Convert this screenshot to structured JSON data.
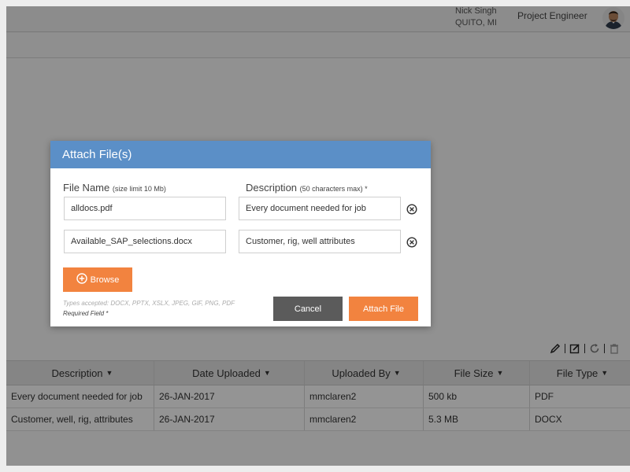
{
  "header": {
    "user_name": "Nick Singh",
    "user_location": "QUITO, MI",
    "user_role": "Project Engineer"
  },
  "modal": {
    "title": "Attach File(s)",
    "file_name_label": "File Name",
    "file_name_hint": "(size limit 10 Mb)",
    "description_label": "Description",
    "description_hint": "(50 characters max) *",
    "files": [
      {
        "name": "alldocs.pdf",
        "description": "Every document needed for job"
      },
      {
        "name": "Available_SAP_selections.docx",
        "description": "Customer, rig, well attributes"
      }
    ],
    "browse_label": "Browse",
    "types_accepted": "Types accepted: DOCX, PPTX, XSLX, JPEG, GIF, PNG, PDF",
    "required_note": "Required Field *",
    "cancel_label": "Cancel",
    "attach_label": "Attach File"
  },
  "grid": {
    "columns": [
      "Description",
      "Date Uploaded",
      "Uploaded By",
      "File Size",
      "File Type"
    ],
    "rows": [
      [
        "Every document needed for job",
        "26-JAN-2017",
        "mmclaren2",
        "500 kb",
        "PDF"
      ],
      [
        "Customer, well, rig, attributes",
        "26-JAN-2017",
        "mmclaren2",
        "5.3 MB",
        "DOCX"
      ]
    ]
  },
  "colors": {
    "modal_header": "#5b8fc7",
    "accent_orange": "#f2833f",
    "cancel_gray": "#5b5b5b"
  },
  "icons": [
    "avatar",
    "edit-icon",
    "note-icon",
    "refresh-icon",
    "trash-icon",
    "remove-icon",
    "plus-circle-icon",
    "caret-down-icon"
  ]
}
